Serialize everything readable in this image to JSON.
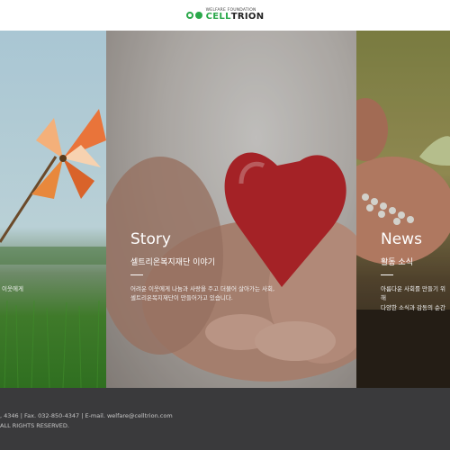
{
  "header": {
    "logo_sub": "WELFARE FOUNDATION",
    "logo_name_bold": "CELL",
    "logo_name_rest": "TRION"
  },
  "panels": {
    "left": {
      "desc": "이웃에게"
    },
    "center": {
      "title": "Story",
      "subtitle": "셀트리온복지재단 이야기",
      "desc_line1": "어려운 이웃에게 나눔과 사랑을 주고 더불어 살아가는 사회,",
      "desc_line2": "셀트리온복지재단이 만들어가고 있습니다."
    },
    "right": {
      "title": "News",
      "subtitle": "활동 소식",
      "desc_line1": "아름다운 사회를 만들기 위해",
      "desc_line2": "다양한 소식과 감동의 순간"
    }
  },
  "footer": {
    "line1": ", 4346  |  Fax. 032-850-4347  |  E-mail. welfare@celltrion.com",
    "line2": "ALL RIGHTS RESERVED."
  },
  "colors": {
    "brand_green": "#2aa84a",
    "footer_bg": "#3a3a3c"
  }
}
